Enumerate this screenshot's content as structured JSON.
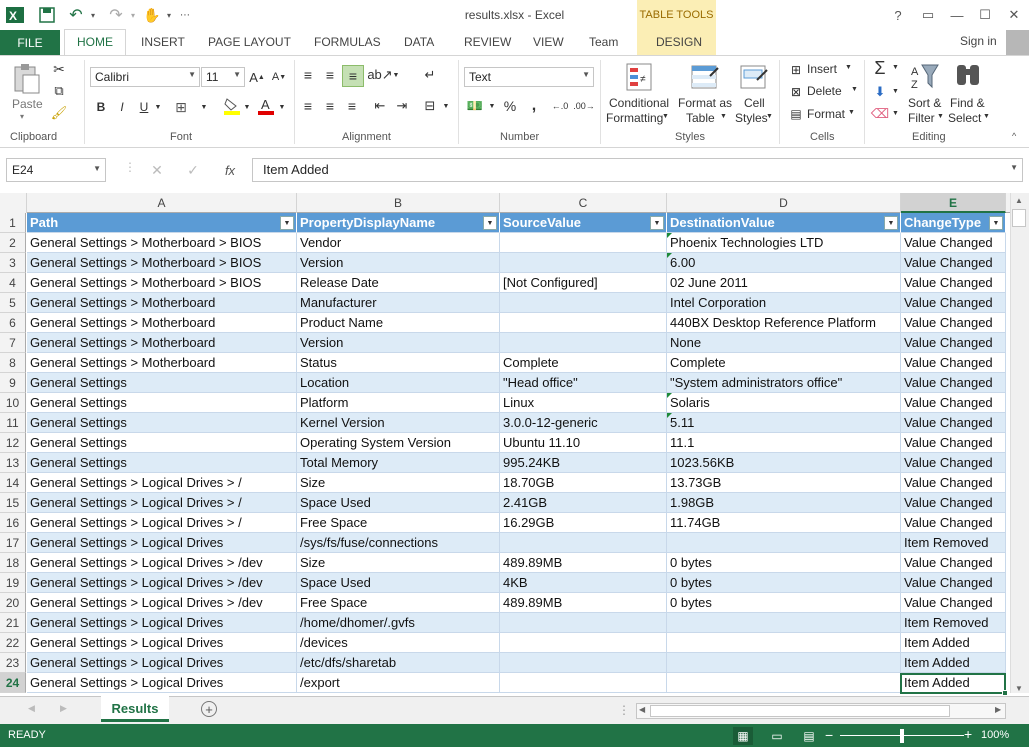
{
  "window": {
    "title": "results.xlsx - Excel",
    "table_tools": "TABLE TOOLS",
    "help": "?"
  },
  "tabs": [
    "HOME",
    "INSERT",
    "PAGE LAYOUT",
    "FORMULAS",
    "DATA",
    "REVIEW",
    "VIEW",
    "Team",
    "DESIGN"
  ],
  "file_tab": "FILE",
  "signin": "Sign in",
  "ribbon": {
    "paste": "Paste",
    "font_name": "Calibri",
    "font_size": "11",
    "number_format": "Text",
    "percent": "%",
    "comma": ",",
    "conditional_formatting": [
      "Conditional",
      "Formatting"
    ],
    "format_as_table": [
      "Format as",
      "Table"
    ],
    "cell_styles": [
      "Cell",
      "Styles"
    ],
    "insert": "Insert",
    "delete": "Delete",
    "format": "Format",
    "sort_filter": [
      "Sort &",
      "Filter"
    ],
    "find_select": [
      "Find &",
      "Select"
    ],
    "groups": [
      "Clipboard",
      "Font",
      "Alignment",
      "Number",
      "Styles",
      "Cells",
      "Editing"
    ]
  },
  "formula_bar": {
    "name_box": "E24",
    "formula": "Item Added",
    "fx": "fx"
  },
  "columns": [
    "A",
    "B",
    "C",
    "D",
    "E"
  ],
  "header": [
    "Path",
    "PropertyDisplayName",
    "SourceValue",
    "DestinationValue",
    "ChangeType"
  ],
  "rows": [
    [
      "General Settings > Motherboard > BIOS",
      "Vendor",
      "",
      "Phoenix Technologies LTD",
      "Value Changed"
    ],
    [
      "General Settings > Motherboard > BIOS",
      "Version",
      "",
      "6.00",
      "Value Changed"
    ],
    [
      "General Settings > Motherboard > BIOS",
      "Release Date",
      "[Not Configured]",
      "02 June 2011",
      "Value Changed"
    ],
    [
      "General Settings > Motherboard",
      "Manufacturer",
      "",
      "Intel Corporation",
      "Value Changed"
    ],
    [
      "General Settings > Motherboard",
      "Product Name",
      "",
      "440BX Desktop Reference Platform",
      "Value Changed"
    ],
    [
      "General Settings > Motherboard",
      "Version",
      "",
      "None",
      "Value Changed"
    ],
    [
      "General Settings > Motherboard",
      "Status",
      "Complete",
      "Complete",
      "Value Changed"
    ],
    [
      "General Settings",
      "Location",
      "\"Head office\"",
      "\"System administrators office\"",
      "Value Changed"
    ],
    [
      "General Settings",
      "Platform",
      "Linux",
      "Solaris",
      "Value Changed"
    ],
    [
      "General Settings",
      "Kernel Version",
      "3.0.0-12-generic",
      "5.11",
      "Value Changed"
    ],
    [
      "General Settings",
      "Operating System Version",
      "Ubuntu 11.10",
      "11.1",
      "Value Changed"
    ],
    [
      "General Settings",
      "Total Memory",
      "995.24KB",
      "1023.56KB",
      "Value Changed"
    ],
    [
      "General Settings > Logical Drives > /",
      "Size",
      "18.70GB",
      "13.73GB",
      "Value Changed"
    ],
    [
      "General Settings > Logical Drives > /",
      "Space Used",
      "2.41GB",
      "1.98GB",
      "Value Changed"
    ],
    [
      "General Settings > Logical Drives > /",
      "Free Space",
      "16.29GB",
      "11.74GB",
      "Value Changed"
    ],
    [
      "General Settings > Logical Drives",
      "/sys/fs/fuse/connections",
      "",
      "",
      "Item Removed"
    ],
    [
      "General Settings > Logical Drives > /dev",
      "Size",
      "489.89MB",
      "0 bytes",
      "Value Changed"
    ],
    [
      "General Settings > Logical Drives > /dev",
      "Space Used",
      "4KB",
      "0 bytes",
      "Value Changed"
    ],
    [
      "General Settings > Logical Drives > /dev",
      "Free Space",
      "489.89MB",
      "0 bytes",
      "Value Changed"
    ],
    [
      "General Settings > Logical Drives",
      "/home/dhomer/.gvfs",
      "",
      "",
      "Item Removed"
    ],
    [
      "General Settings > Logical Drives",
      "/devices",
      "",
      "",
      "Item Added"
    ],
    [
      "General Settings > Logical Drives",
      "/etc/dfs/sharetab",
      "",
      "",
      "Item Added"
    ],
    [
      "General Settings > Logical Drives",
      "/export",
      "",
      "",
      "Item Added"
    ]
  ],
  "sheet_tab": "Results",
  "status": "READY",
  "zoom": "100%",
  "colors": {
    "excel_green": "#217346",
    "table_header": "#5b9bd5",
    "band": "#ddebf7"
  }
}
